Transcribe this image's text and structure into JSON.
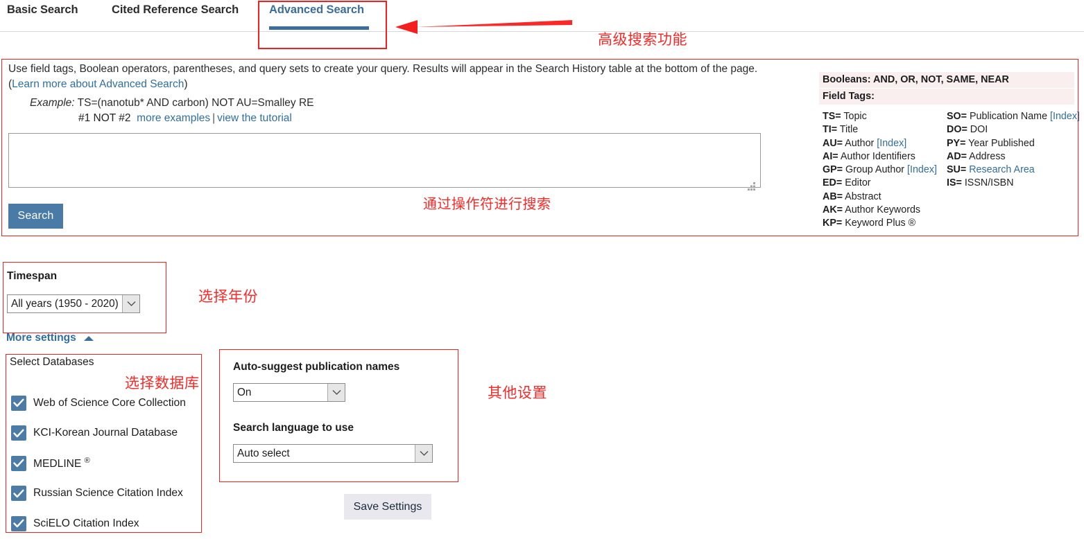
{
  "tabs": [
    {
      "label": "Basic Search",
      "active": false
    },
    {
      "label": "Cited Reference Search",
      "active": false
    },
    {
      "label": "Advanced Search",
      "active": true
    }
  ],
  "annotations": {
    "advanced_feature": "高级搜索功能",
    "operator_search": "通过操作符进行搜索",
    "select_year": "选择年份",
    "select_database": "选择数据库",
    "other_settings": "其他设置"
  },
  "instructions": {
    "text_before_link": "Use field tags, Boolean operators, parentheses, and query sets to create your query. Results will appear in the Search History table at the bottom of the page.(",
    "link_label": "Learn more about Advanced Search",
    "text_after_link": ")"
  },
  "example": {
    "label": "Example:",
    "query": "TS=(nanotub* AND carbon) NOT AU=Smalley RE",
    "second_line": "#1 NOT #2",
    "more_examples_link": "more examples",
    "separator": "|",
    "tutorial_link": "view the tutorial"
  },
  "query_field": {
    "value": "",
    "placeholder": ""
  },
  "buttons": {
    "search": "Search",
    "save_settings": "Save Settings"
  },
  "field_tags_panel": {
    "booleans_heading": "Booleans: AND, OR, NOT, SAME, NEAR",
    "field_tags_heading": "Field Tags:",
    "left_column": [
      {
        "code": "TS",
        "eq": "=",
        "name": " Topic",
        "index": ""
      },
      {
        "code": "TI",
        "eq": "=",
        "name": " Title",
        "index": ""
      },
      {
        "code": "AU",
        "eq": "=",
        "name": " Author ",
        "index": "[Index]"
      },
      {
        "code": "AI",
        "eq": "=",
        "name": " Author Identifiers",
        "index": ""
      },
      {
        "code": "GP",
        "eq": "=",
        "name": " Group Author ",
        "index": "[Index]"
      },
      {
        "code": "ED",
        "eq": "=",
        "name": " Editor",
        "index": ""
      },
      {
        "code": "AB",
        "eq": "=",
        "name": " Abstract",
        "index": ""
      },
      {
        "code": "AK",
        "eq": "=",
        "name": " Author Keywords",
        "index": ""
      },
      {
        "code": "KP",
        "eq": "=",
        "name": " Keyword Plus ®",
        "index": ""
      }
    ],
    "right_column": [
      {
        "code": "SO",
        "eq": "=",
        "name": " Publication Name ",
        "index": "[Index]"
      },
      {
        "code": "DO",
        "eq": "=",
        "name": " DOI",
        "index": ""
      },
      {
        "code": "PY",
        "eq": "=",
        "name": " Year Published",
        "index": ""
      },
      {
        "code": "AD",
        "eq": "=",
        "name": " Address",
        "index": ""
      },
      {
        "code": "SU",
        "eq": "=",
        "name": "",
        "index": "",
        "link": " Research Area"
      },
      {
        "code": "IS",
        "eq": "=",
        "name": " ISSN/ISBN",
        "index": ""
      }
    ]
  },
  "timespan": {
    "label": "Timespan",
    "selected": "All years (1950 - 2020)"
  },
  "more_settings": {
    "label": "More settings",
    "expanded": true
  },
  "databases": {
    "title": "Select Databases",
    "items": [
      {
        "label": "Web of Science Core Collection",
        "checked": true,
        "sup": ""
      },
      {
        "label": "KCI-Korean Journal Database",
        "checked": true,
        "sup": ""
      },
      {
        "label": "MEDLINE ",
        "checked": true,
        "sup": "®"
      },
      {
        "label": "Russian Science Citation Index",
        "checked": true,
        "sup": ""
      },
      {
        "label": "SciELO Citation Index",
        "checked": true,
        "sup": ""
      }
    ]
  },
  "other_settings": {
    "autosuggest_label": "Auto-suggest publication names",
    "autosuggest_value": "On",
    "language_label": "Search language to use",
    "language_value": "Auto select"
  },
  "colors": {
    "annotation_red": "#fb2828",
    "accent_blue": "#3b6e9b",
    "link_blue": "#2f6f9f",
    "button_blue": "#4a7ba6",
    "checkbox_blue": "#4c7ba5",
    "heading_bg": "#f9efef",
    "save_button_bg": "#e8e8ee"
  }
}
